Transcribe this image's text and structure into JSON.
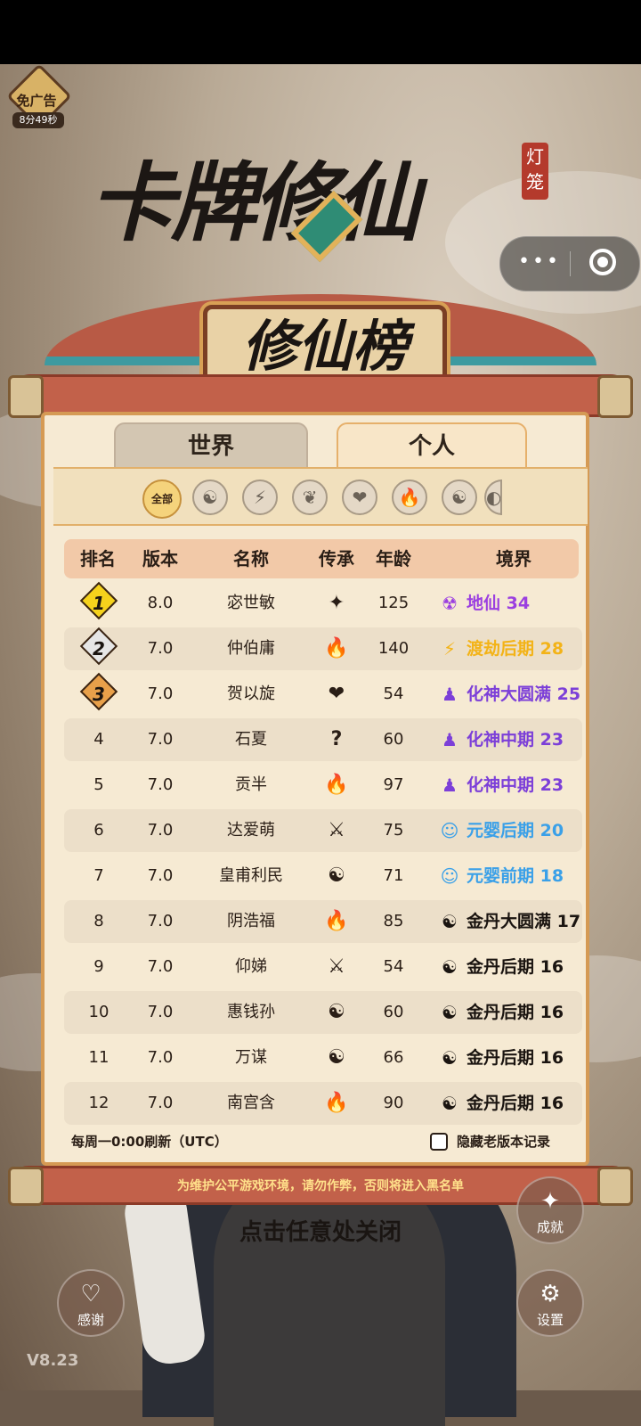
{
  "ad": {
    "label": "免广告",
    "timer": "8分49秒"
  },
  "game_title": "卡牌修仙",
  "seal": "灯笼",
  "capsule": {
    "more": "•••"
  },
  "banner": "修仙榜",
  "tabs": [
    "世界",
    "个人"
  ],
  "filters": {
    "all": "全部",
    "icons": [
      "☯",
      "⚡",
      "❦",
      "❤",
      "🔥",
      "☯",
      "◐"
    ]
  },
  "table": {
    "headers": [
      "排名",
      "版本",
      "名称",
      "传承",
      "年龄",
      "境界"
    ],
    "rows": [
      {
        "rank": "1",
        "version": "8.0",
        "name": "宓世敏",
        "heritage": "✦",
        "age": "125",
        "realm": "地仙 34",
        "realm_color": "#9b3fe0",
        "realm_icon": "☢"
      },
      {
        "rank": "2",
        "version": "7.0",
        "name": "仲伯庸",
        "heritage": "🔥",
        "age": "140",
        "realm": "渡劫后期 28",
        "realm_color": "#f3b317",
        "realm_icon": "⚡"
      },
      {
        "rank": "3",
        "version": "7.0",
        "name": "贺以旋",
        "heritage": "❤",
        "age": "54",
        "realm": "化神大圆满 25",
        "realm_color": "#7c3fd8",
        "realm_icon": "♟"
      },
      {
        "rank": "4",
        "version": "7.0",
        "name": "石夏",
        "heritage": "?",
        "age": "60",
        "realm": "化神中期 23",
        "realm_color": "#7c3fd8",
        "realm_icon": "♟"
      },
      {
        "rank": "5",
        "version": "7.0",
        "name": "贡半",
        "heritage": "🔥",
        "age": "97",
        "realm": "化神中期 23",
        "realm_color": "#7c3fd8",
        "realm_icon": "♟"
      },
      {
        "rank": "6",
        "version": "7.0",
        "name": "达爱萌",
        "heritage": "⚔",
        "age": "75",
        "realm": "元婴后期 20",
        "realm_color": "#3aa0e8",
        "realm_icon": "☺"
      },
      {
        "rank": "7",
        "version": "7.0",
        "name": "皇甫利民",
        "heritage": "☯",
        "age": "71",
        "realm": "元婴前期 18",
        "realm_color": "#3aa0e8",
        "realm_icon": "☺"
      },
      {
        "rank": "8",
        "version": "7.0",
        "name": "阴浩福",
        "heritage": "🔥",
        "age": "85",
        "realm": "金丹大圆满 17",
        "realm_color": "#1a1410",
        "realm_icon": "☯"
      },
      {
        "rank": "9",
        "version": "7.0",
        "name": "仰娣",
        "heritage": "⚔",
        "age": "54",
        "realm": "金丹后期 16",
        "realm_color": "#1a1410",
        "realm_icon": "☯"
      },
      {
        "rank": "10",
        "version": "7.0",
        "name": "惠钱孙",
        "heritage": "☯",
        "age": "60",
        "realm": "金丹后期 16",
        "realm_color": "#1a1410",
        "realm_icon": "☯"
      },
      {
        "rank": "11",
        "version": "7.0",
        "name": "万谋",
        "heritage": "☯",
        "age": "66",
        "realm": "金丹后期 16",
        "realm_color": "#1a1410",
        "realm_icon": "☯"
      },
      {
        "rank": "12",
        "version": "7.0",
        "name": "南宫含",
        "heritage": "🔥",
        "age": "90",
        "realm": "金丹后期 16",
        "realm_color": "#1a1410",
        "realm_icon": "☯"
      }
    ]
  },
  "footer": {
    "refresh": "每周一0:00刷新（UTC）",
    "hide_old": "隐藏老版本记录"
  },
  "notice": "为维护公平游戏环境，请勿作弊，否则将进入黑名单",
  "close_hint": "点击任意处关闭",
  "buttons": {
    "achievement": "成就",
    "thanks": "感谢",
    "settings": "设置"
  },
  "version": "V8.23",
  "colors": {
    "panel": "#f6ead3",
    "rod": "#c2614a",
    "rank1": "#f5d21c",
    "rank2": "#e6e6e6",
    "rank3": "#e8a04a"
  }
}
